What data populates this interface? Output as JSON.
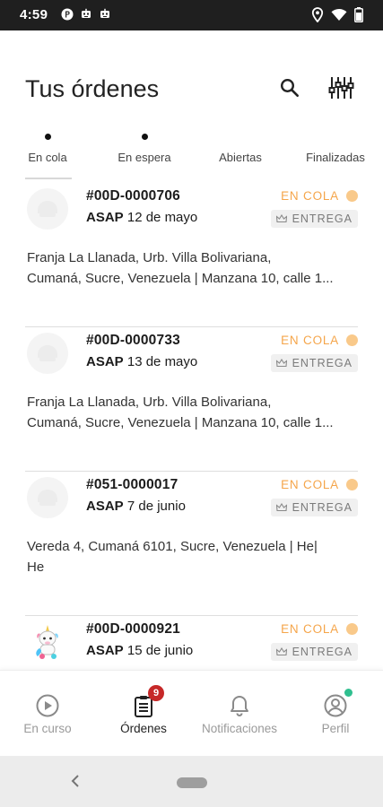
{
  "status_bar": {
    "time": "4:59",
    "left_icons": [
      "notification-p-icon",
      "robot-icon",
      "robot-icon"
    ],
    "right_icons": [
      "location-icon",
      "wifi-icon",
      "battery-icon"
    ]
  },
  "header": {
    "title_light": "Tus",
    "title_bold": "órdenes",
    "actions": [
      "search-icon",
      "filter-sliders-icon"
    ]
  },
  "tabs": [
    {
      "label": "En cola",
      "has_dot": true,
      "active": true
    },
    {
      "label": "En espera",
      "has_dot": true,
      "active": false
    },
    {
      "label": "Abiertas",
      "has_dot": false,
      "active": false
    },
    {
      "label": "Finalizadas",
      "has_dot": false,
      "active": false
    }
  ],
  "orders": [
    {
      "id": "#00D-0000706",
      "asap": "ASAP",
      "date": "12 de mayo",
      "status": "EN COLA",
      "type": "ENTREGA",
      "address_line1": "Franja La Llanada, Urb. Villa Bolivariana,",
      "address_line2": "Cumaná, Sucre, Venezuela | Manzana 10, calle 1...",
      "avatar": "placeholder-avatar-icon"
    },
    {
      "id": "#00D-0000733",
      "asap": "ASAP",
      "date": "13 de mayo",
      "status": "EN COLA",
      "type": "ENTREGA",
      "address_line1": "Franja La Llanada, Urb. Villa Bolivariana,",
      "address_line2": "Cumaná, Sucre, Venezuela | Manzana 10, calle 1...",
      "avatar": "placeholder-avatar-icon"
    },
    {
      "id": "#051-0000017",
      "asap": "ASAP",
      "date": "7 de junio",
      "status": "EN COLA",
      "type": "ENTREGA",
      "address_line1": "Vereda 4, Cumaná 6101, Sucre, Venezuela | He|",
      "address_line2": "He",
      "avatar": "placeholder-avatar-icon"
    },
    {
      "id": "#00D-0000921",
      "asap": "ASAP",
      "date": "15 de junio",
      "status": "EN COLA",
      "type": "ENTREGA",
      "address_line1": "",
      "address_line2": "",
      "avatar": "unicorn-avatar-icon"
    }
  ],
  "bottom_nav": [
    {
      "label": "En curso",
      "icon": "play-circle-icon",
      "active": false
    },
    {
      "label": "Órdenes",
      "icon": "clipboard-list-icon",
      "active": true,
      "badge": "9"
    },
    {
      "label": "Notificaciones",
      "icon": "bell-icon",
      "active": false
    },
    {
      "label": "Perfil",
      "icon": "user-circle-icon",
      "active": false,
      "online": true
    }
  ],
  "colors": {
    "status_orange": "#f5a54a",
    "status_dot": "#f9c98a",
    "badge_red": "#c62828",
    "online_green": "#2fbf8f",
    "status_bar": "#1f1f1f"
  }
}
